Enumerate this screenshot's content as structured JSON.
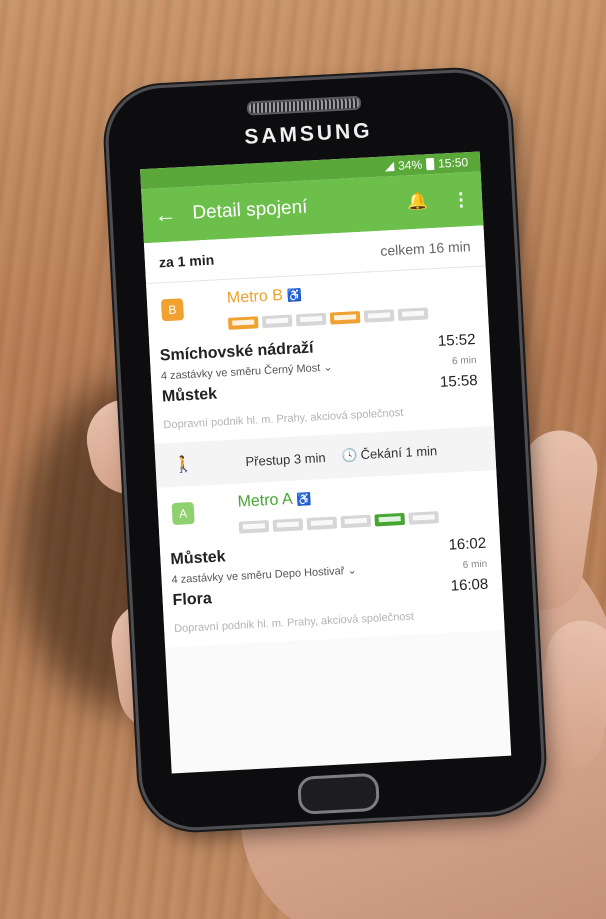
{
  "device": {
    "brand": "SAMSUNG"
  },
  "status_bar": {
    "signal": "",
    "battery": "34%",
    "time": "15:50"
  },
  "app_bar": {
    "back_icon": "arrow-left-icon",
    "title": "Detail spojení",
    "bell_icon": "bell-icon",
    "menu_icon": "more-vertical-icon"
  },
  "summary": {
    "departure": "za 1 min",
    "total": "celkem 16 min"
  },
  "legs": [
    {
      "line": "Metro B",
      "color": "#f1a130",
      "icon_text": "B",
      "highlighted_cars": [
        1,
        4
      ],
      "from_stop": "Smíchovské nádraží",
      "from_time": "15:52",
      "direction": "4 zastávky ve směru Černý Most ⌄",
      "duration": "6 min",
      "to_stop": "Můstek",
      "to_time": "15:58",
      "operator": "Dopravní podnik hl. m. Prahy, akciová společnost"
    },
    {
      "line": "Metro A",
      "color": "#47a532",
      "icon_text": "A",
      "highlighted_cars": [
        5
      ],
      "from_stop": "Můstek",
      "from_time": "16:02",
      "direction": "4 zastávky ve směru Depo Hostivař ⌄",
      "duration": "6 min",
      "to_stop": "Flora",
      "to_time": "16:08",
      "operator": "Dopravní podnik hl. m. Prahy, akciová společnost"
    }
  ],
  "transfer": {
    "walk": "Přestup 3 min",
    "wait": "Čekání 1 min"
  }
}
